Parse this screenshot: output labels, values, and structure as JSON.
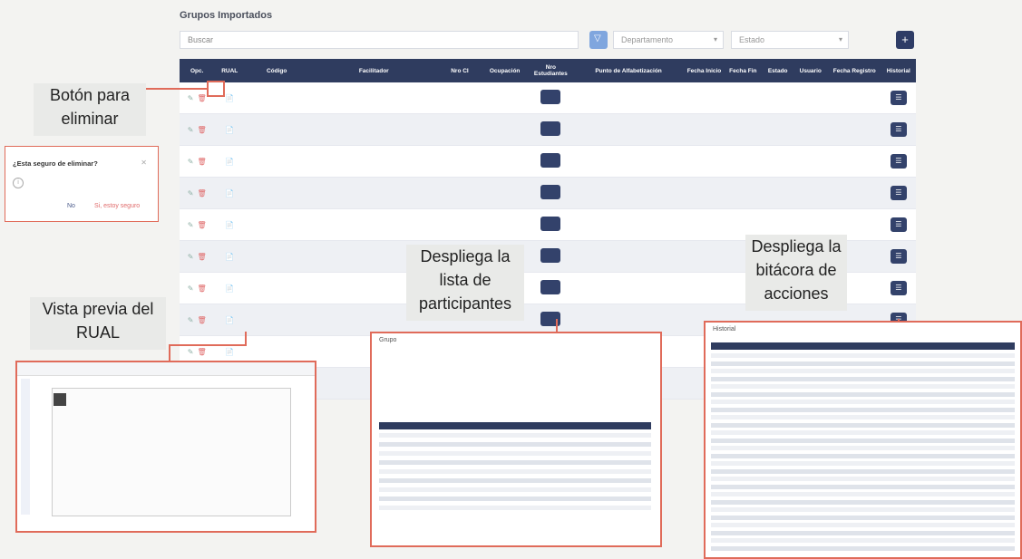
{
  "page": {
    "title": "Grupos Importados"
  },
  "toolbar": {
    "search_placeholder": "Buscar",
    "department_placeholder": "Departamento",
    "status_placeholder": "Estado",
    "add_label": "+"
  },
  "columns": [
    "Opc.",
    "RUAL",
    "Código",
    "Facilitador",
    "Nro CI",
    "Ocupación",
    "Nro Estudiantes",
    "Punto de Alfabetización",
    "Fecha Inicio",
    "Fecha Fin",
    "Estado",
    "Usuario",
    "Fecha Registro",
    "Historial"
  ],
  "rows": [
    {
      "codigo": "",
      "facilitador": "",
      "ci": "",
      "ocupacion": "",
      "estudiantes": "",
      "punto": "",
      "inicio": "",
      "fin": "",
      "estado": "",
      "usuario": "",
      "registro": "",
      "red": false
    },
    {
      "codigo": "",
      "facilitador": "",
      "ci": "",
      "ocupacion": "",
      "estudiantes": "",
      "punto": "",
      "inicio": "",
      "fin": "",
      "estado": "",
      "usuario": "",
      "registro": "",
      "red": false
    },
    {
      "codigo": "",
      "facilitador": "",
      "ci": "",
      "ocupacion": "",
      "estudiantes": "",
      "punto": "",
      "inicio": "",
      "fin": "",
      "estado": "",
      "usuario": "",
      "registro": "",
      "red": false
    },
    {
      "codigo": "",
      "facilitador": "",
      "ci": "",
      "ocupacion": "",
      "estudiantes": "",
      "punto": "",
      "inicio": "",
      "fin": "",
      "estado": "",
      "usuario": "",
      "registro": "",
      "red": false
    },
    {
      "codigo": "",
      "facilitador": "",
      "ci": "",
      "ocupacion": "",
      "estudiantes": "",
      "punto": "",
      "inicio": "",
      "fin": "",
      "estado": "",
      "usuario": "",
      "registro": "",
      "red": false
    },
    {
      "codigo": "",
      "facilitador": "",
      "ci": "",
      "ocupacion": "",
      "estudiantes": "",
      "punto": "",
      "inicio": "",
      "fin": "",
      "estado": "",
      "usuario": "",
      "registro": "",
      "red": false
    },
    {
      "codigo": "",
      "facilitador": "",
      "ci": "",
      "ocupacion": "",
      "estudiantes": "",
      "punto": "",
      "inicio": "",
      "fin": "",
      "estado": "",
      "usuario": "",
      "registro": "",
      "red": true
    },
    {
      "codigo": "",
      "facilitador": "",
      "ci": "",
      "ocupacion": "",
      "estudiantes": "",
      "punto": "",
      "inicio": "",
      "fin": "",
      "estado": "",
      "usuario": "",
      "registro": "",
      "red": true
    },
    {
      "codigo": "",
      "facilitador": "",
      "ci": "",
      "ocupacion": "",
      "estudiantes": "",
      "punto": "",
      "inicio": "",
      "fin": "",
      "estado": "",
      "usuario": "",
      "registro": "",
      "red": false
    },
    {
      "codigo": "",
      "facilitador": "",
      "ci": "",
      "ocupacion": "",
      "estudiantes": "",
      "punto": "",
      "inicio": "",
      "fin": "",
      "estado": "",
      "usuario": "",
      "registro": "",
      "red": true
    }
  ],
  "callouts": {
    "eliminar": "Botón para eliminar",
    "participantes": "Despliega la lista de participantes",
    "bitacora": "Despliega la bitácora de acciones",
    "rual": "Vista previa del RUAL"
  },
  "confirm_dialog": {
    "title": "¿Esta seguro de eliminar?",
    "message": "",
    "no_label": "No",
    "yes_label": "Si, estoy seguro"
  },
  "group_panel": {
    "title": "Grupo"
  },
  "history_panel": {
    "title": "Historial"
  },
  "colors": {
    "header": "#2f3c5f",
    "accent": "#e06b5a",
    "danger": "#e06b6b"
  }
}
